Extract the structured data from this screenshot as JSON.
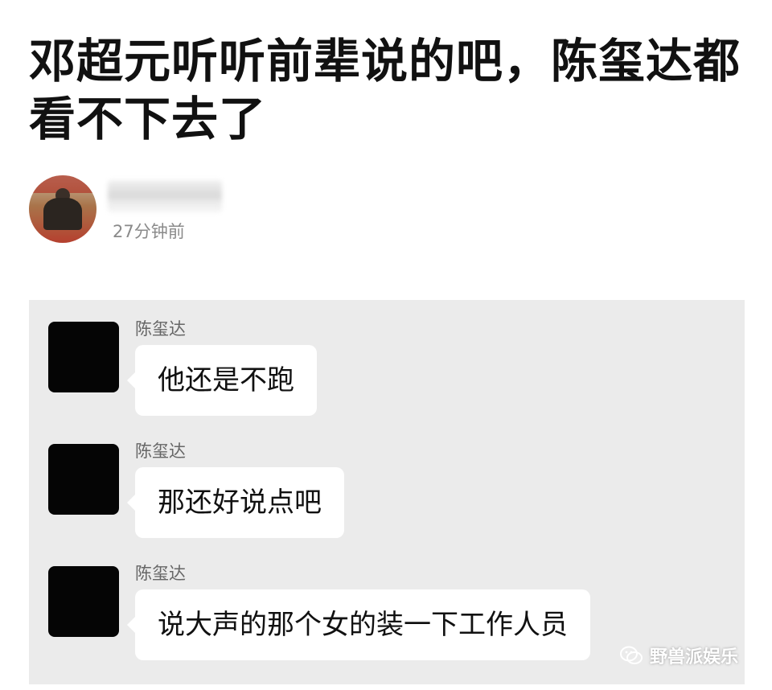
{
  "article": {
    "title": "邓超元听听前辈说的吧，陈玺达都看不下去了",
    "author_time": "27分钟前"
  },
  "chat": {
    "messages": [
      {
        "sender": "陈玺达",
        "text": "他还是不跑"
      },
      {
        "sender": "陈玺达",
        "text": "那还好说点吧"
      },
      {
        "sender": "陈玺达",
        "text": "说大声的那个女的装一下工作人员"
      }
    ]
  },
  "watermark": {
    "text": "野兽派娱乐",
    "icon": "wechat-icon"
  }
}
